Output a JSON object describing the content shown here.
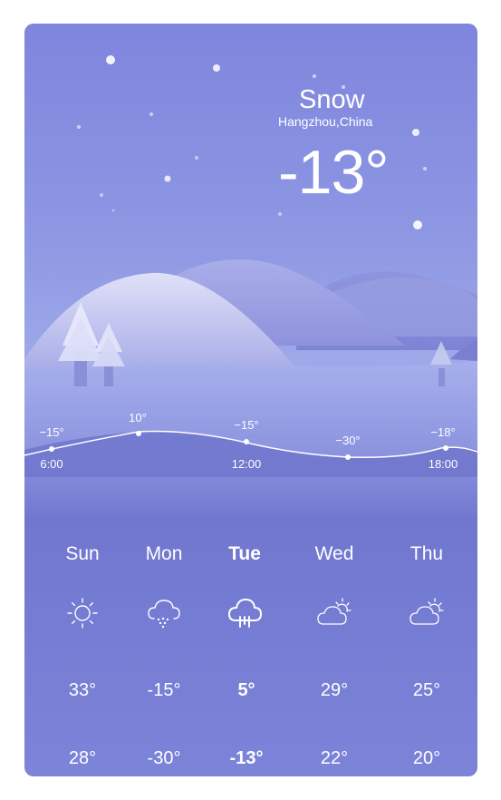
{
  "header": {
    "condition": "Snow",
    "location": "Hangzhou,China",
    "temperature": "-13°"
  },
  "hourly": [
    {
      "temp": "−15°",
      "time": "6:00"
    },
    {
      "temp": "10°",
      "time": ""
    },
    {
      "temp": "−15°",
      "time": "12:00"
    },
    {
      "temp": "−30°",
      "time": ""
    },
    {
      "temp": "−18°",
      "time": "18:00"
    }
  ],
  "forecast": [
    {
      "day": "Sun",
      "icon": "sun-icon",
      "high": "33°",
      "low": "28°",
      "selected": false
    },
    {
      "day": "Mon",
      "icon": "snow-cloud-icon",
      "high": "-15°",
      "low": "-30°",
      "selected": false
    },
    {
      "day": "Tue",
      "icon": "rain-cloud-icon",
      "high": "5°",
      "low": "-13°",
      "selected": true
    },
    {
      "day": "Wed",
      "icon": "partly-cloudy-icon",
      "high": "29°",
      "low": "22°",
      "selected": false
    },
    {
      "day": "Thu",
      "icon": "partly-cloudy-icon",
      "high": "25°",
      "low": "20°",
      "selected": false
    }
  ]
}
